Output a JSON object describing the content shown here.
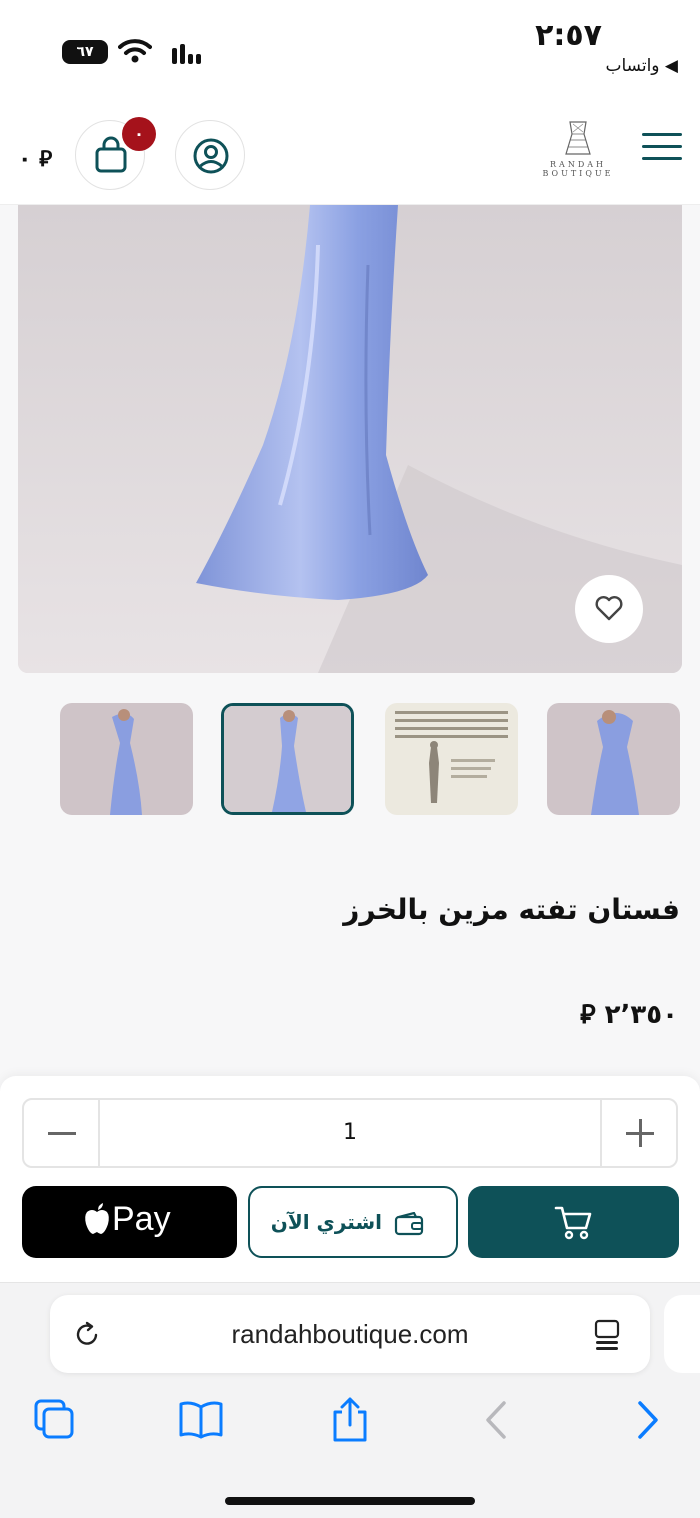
{
  "status_bar": {
    "time": "٢:٥٧",
    "back_app": "واتساب",
    "battery": "٦٧"
  },
  "header": {
    "logo_text": "RANDAH",
    "logo_sub": "BOUTIQUE",
    "cart_count": "٠",
    "cart_total": "٠ ⃁"
  },
  "product": {
    "title": "فستان تفته مزين بالخرز",
    "price": "٢٬٣٥٠ ⃁",
    "dress_color": "#8a9ee0"
  },
  "quantity": {
    "value": "1"
  },
  "buttons": {
    "apple_pay_label": "Pay",
    "buy_now_label": "اشتري الآن"
  },
  "browser": {
    "url": "randahboutique.com"
  },
  "colors": {
    "brand": "#0e5158",
    "badge": "#a5121b"
  }
}
